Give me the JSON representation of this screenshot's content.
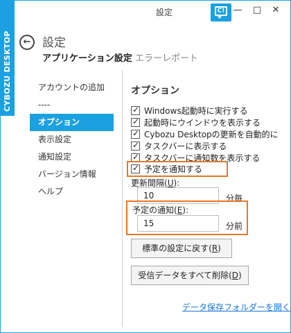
{
  "window": {
    "title": "設定",
    "min_glyph": "—",
    "max_glyph": "□",
    "close_glyph": "✕"
  },
  "brand": {
    "side_label": "CYBOZU DESKTOP",
    "logo_text": "C!",
    "accent": "#1ba1e2"
  },
  "header": {
    "back_glyph": "←",
    "page_title": "設定"
  },
  "tabs": [
    {
      "label": "アプリケーション設定",
      "active": true
    },
    {
      "label": "エラーレポート",
      "active": false
    }
  ],
  "sidebar": {
    "items": [
      {
        "label": "アカウントの追加",
        "selected": false
      },
      {
        "label": "----",
        "selected": false
      },
      {
        "label": "オプション",
        "selected": true
      },
      {
        "label": "表示設定",
        "selected": false
      },
      {
        "label": "通知設定",
        "selected": false
      },
      {
        "label": "バージョン情報",
        "selected": false
      },
      {
        "label": "ヘルプ",
        "selected": false
      }
    ]
  },
  "options": {
    "title": "オプション",
    "checkboxes": [
      {
        "label": "Windows起動時に実行する",
        "checked": true
      },
      {
        "label": "起動時にウインドウを表示する",
        "checked": true
      },
      {
        "label": "Cybozu Desktopの更新を自動的に",
        "checked": true
      },
      {
        "label": "タスクバーに表示する",
        "checked": true
      },
      {
        "label": "タスクバーに通知数を表示する",
        "checked": true
      },
      {
        "label": "予定を通知する",
        "checked": true
      }
    ],
    "update_interval": {
      "label_prefix": "更新間隔(",
      "label_key": "U",
      "label_suffix": "):",
      "value": "10",
      "unit": "分毎"
    },
    "schedule_notify": {
      "label_prefix": "予定の通知(",
      "label_key": "E",
      "label_suffix": "):",
      "value": "15",
      "unit": "分前"
    },
    "buttons": {
      "reset": {
        "prefix": "標準の設定に戻す(",
        "key": "R",
        "suffix": ")"
      },
      "delete_all": {
        "prefix": "受信データをすべて削除(",
        "key": "D",
        "suffix": ")"
      }
    },
    "link": "データ保存フォルダーを開く"
  },
  "highlight_color": "#e87722"
}
